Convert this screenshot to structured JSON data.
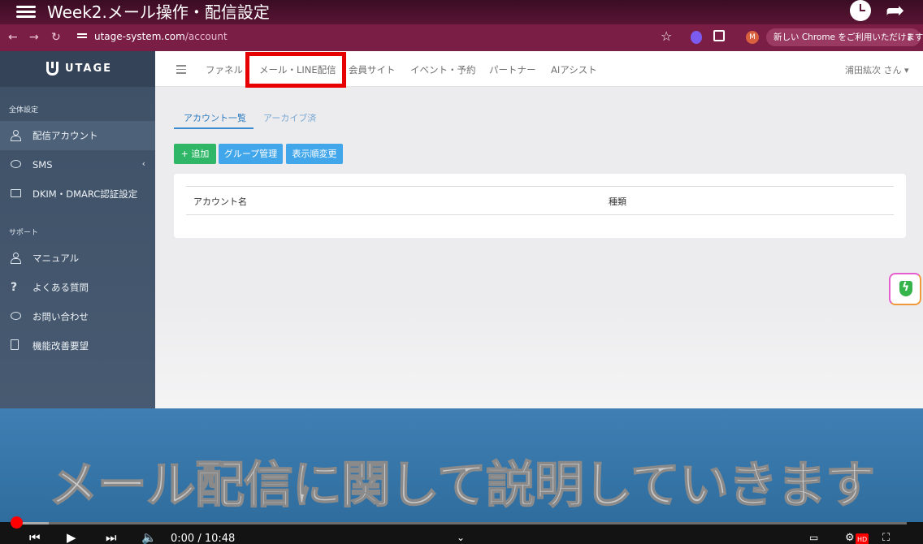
{
  "video": {
    "title": "Week2.メール操作・配信設定",
    "caption": "メール配信に関して説明していきます",
    "time": "0:00 / 10:48",
    "progress": 0.0,
    "hd_badge": "HD"
  },
  "browser": {
    "url_host": "utage-system.com",
    "url_path": "/account",
    "profile_initial": "M",
    "update_message": "新しい Chrome をご利用いただけます",
    "menu_dots": "⋮"
  },
  "app": {
    "logo_text": "UTAGE",
    "sidebar": {
      "section1_label": "全体設定",
      "items1": [
        {
          "label": "配信アカウント"
        },
        {
          "label": "SMS"
        },
        {
          "label": "DKIM・DMARC認証設定"
        }
      ],
      "section2_label": "サポート",
      "items2": [
        {
          "label": "マニュアル"
        },
        {
          "label": "よくある質問"
        },
        {
          "label": "お問い合わせ"
        },
        {
          "label": "機能改善要望"
        }
      ]
    },
    "topnav": {
      "links": [
        "ファネル",
        "メール・LINE配信",
        "会員サイト",
        "イベント・予約",
        "パートナー",
        "AIアシスト"
      ],
      "user": "浦田紘次 さん"
    },
    "tabs": [
      "アカウント一覧",
      "アーカイブ済"
    ],
    "buttons": {
      "add": "+ 追加",
      "group": "グループ管理",
      "order": "表示順変更"
    },
    "table": {
      "headers": [
        "アカウント名",
        "種類"
      ]
    }
  },
  "colors": {
    "accent": "#2c7bc0",
    "add_button": "#2fb767",
    "secondary_button": "#42a6ea",
    "highlight": "#e60000",
    "sidebar": "#475a71"
  }
}
